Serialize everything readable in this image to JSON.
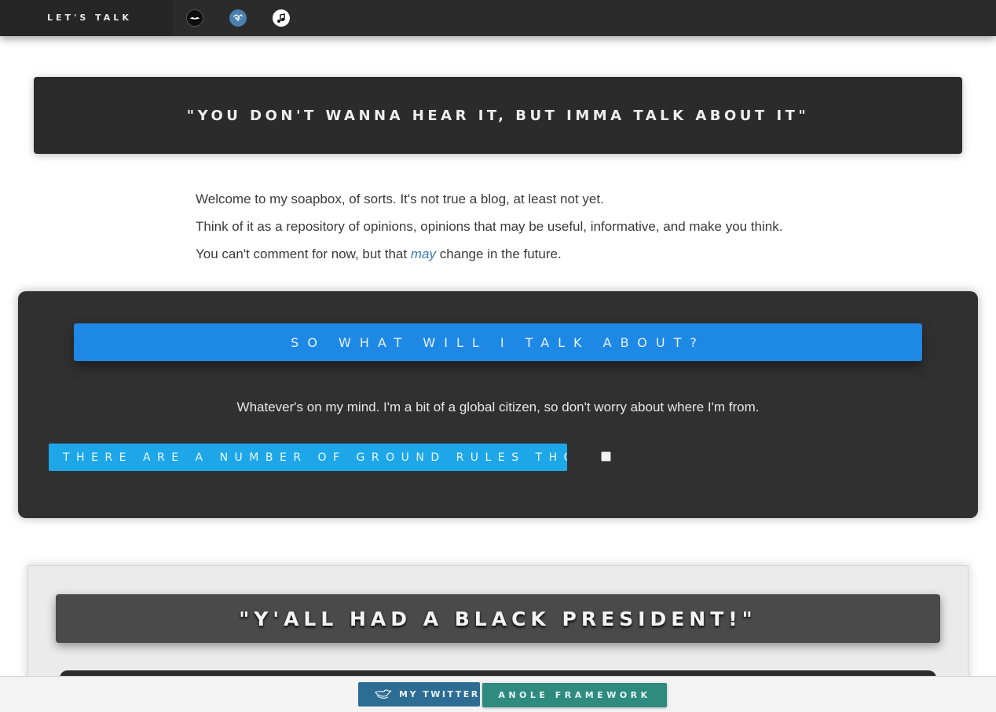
{
  "nav": {
    "brand": "LET'S TALK",
    "icons": [
      "mustache-icon",
      "handshake-icon",
      "music-note-icon"
    ]
  },
  "hero": {
    "title": "\"YOU DON'T WANNA HEAR IT, BUT IMMA TALK ABOUT IT\""
  },
  "intro": {
    "line1": "Welcome to my soapbox, of sorts. It's not true a blog, at least not yet.",
    "line2": "Think of it as a repository of opinions, opinions that may be useful, informative, and make you think.",
    "line3_before": "You can't comment for now, but that ",
    "line3_em": "may",
    "line3_after": " change in the future."
  },
  "topics": {
    "heading": "SO WHAT WILL I TALK ABOUT?",
    "text": "Whatever's on my mind. I'm a bit of a global citizen, so don't worry about where I'm from.",
    "rules_label": "THERE ARE A NUMBER OF GROUND RULES THOUGH:",
    "rules_checked": false
  },
  "article": {
    "title": "\"Y'ALL HAD A BLACK PRESIDENT!\""
  },
  "footer": {
    "twitter_label": "MY TWITTER",
    "anole_label": "ANOLE FRAMEWORK"
  },
  "colors": {
    "dark_panel": "#303030",
    "blue_heading": "#1e88e5",
    "rules_blue": "#1ea7e8",
    "twitter": "#2e6d93",
    "anole": "#2f8a80",
    "link": "#3a7bb5"
  }
}
